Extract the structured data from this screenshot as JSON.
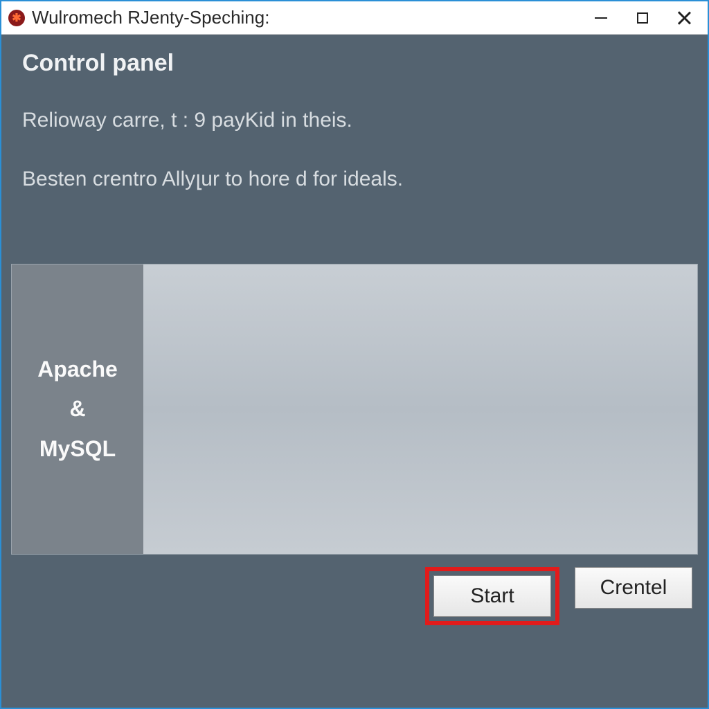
{
  "window": {
    "title": "Wulromech RJenty-Speching:"
  },
  "main": {
    "heading": "Control panel",
    "line1": "Relioway carre, t : 9 payKid in theis.",
    "line2": "Besten crentro Allyլur to hore d for ideals."
  },
  "service": {
    "label_line1": "Apache",
    "label_line2": "&",
    "label_line3": "MySQL"
  },
  "footer": {
    "start_label": "Start",
    "crentel_label": "Crentel"
  }
}
